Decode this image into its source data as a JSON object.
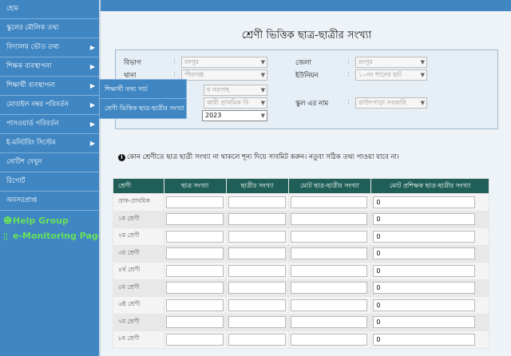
{
  "sidebar": {
    "items": [
      {
        "label": "হোম",
        "arrow": ""
      },
      {
        "label": "স্কুলের মৌলিক তথ্য",
        "arrow": ""
      },
      {
        "label": "বিদ্যালয় ভৌত তথ্য",
        "arrow": "▶"
      },
      {
        "label": "শিক্ষক ব্যবস্থাপনা",
        "arrow": "▶"
      },
      {
        "label": "শিক্ষার্থী ব্যবস্থাপনা",
        "arrow": "▶"
      },
      {
        "label": "মোবাইল নম্বর পরিবর্তন",
        "arrow": "▶"
      },
      {
        "label": "পাসওয়ার্ড পরিবর্তন",
        "arrow": "▶"
      },
      {
        "label": "ই-মনিটরিং সিস্টেম",
        "arrow": "▶"
      },
      {
        "label": "নোটিশ দেখুন",
        "arrow": ""
      },
      {
        "label": "রিপোর্ট",
        "arrow": ""
      },
      {
        "label": "অবসরপ্রাপ্ত",
        "arrow": ""
      }
    ],
    "help_link": "Help Group",
    "monitoring_link": "e-Monitoring Page"
  },
  "submenu": {
    "items": [
      "শিক্ষার্থী তথ্য সার্চ",
      "শ্রেণী ভিত্তিক ছাত্র-ছাত্রীর সংখ্যা"
    ]
  },
  "page": {
    "title": "শ্রেণী ভিত্তিক ছাত্র-ছাত্রীর সংখ্যা"
  },
  "filters": {
    "division_label": "বিভাগ",
    "division_value": "রংপুর",
    "district_label": "জেলা",
    "district_value": "রংপুর",
    "thana_label": "থানা",
    "thana_value": "পীরগঞ্জ",
    "union_label": "ইউনিয়ন",
    "union_value": "১০নং শানের হাট",
    "cluster_value": "ধ নরগাহ",
    "school_type_value": "কারী প্রাথমিক বি",
    "school_name_label": "স্কুল এর নাম",
    "school_name_value": "রাউৎপাড়া সরকারি",
    "year_value": "2023"
  },
  "notice": {
    "icon": "info-icon",
    "text": "কোন শ্রেণীতে ছাত্র ছাত্রী সংখ্যা না থাকলে শূন্য দিয়ে সাবমিট করুন। নতুবা সঠিক তথ্য পাওয়া যাবে না।"
  },
  "table": {
    "headers": [
      "শ্রেণী",
      "ছাত্র সংখ্যা",
      "ছাত্রীর সংখ্যা",
      "মোট ছাত্র-ছাত্রীর সংখ্যা",
      "মোট প্রশিক্ষক ছাত্র-ছাত্রীর সংখ্যা"
    ],
    "rows": [
      {
        "class": "প্রাক-প্রাথমিক",
        "total_trained": "0"
      },
      {
        "class": "১ম শ্রেণী",
        "total_trained": "0"
      },
      {
        "class": "২য় শ্রেণী",
        "total_trained": "0"
      },
      {
        "class": "৩য় শ্রেণী",
        "total_trained": "0"
      },
      {
        "class": "৪র্থ শ্রেণী",
        "total_trained": "0"
      },
      {
        "class": "৫ম শ্রেণী",
        "total_trained": "0"
      },
      {
        "class": "৬ষ্ঠ শ্রেণী",
        "total_trained": "0"
      },
      {
        "class": "৭ম শ্রেণী",
        "total_trained": "0"
      },
      {
        "class": "৮ম শ্রেণী",
        "total_trained": "0"
      }
    ]
  },
  "colors": {
    "sidebar_bg": "#3f86c3",
    "table_header_bg": "#1f5f57",
    "link_green": "#6ae05a"
  }
}
